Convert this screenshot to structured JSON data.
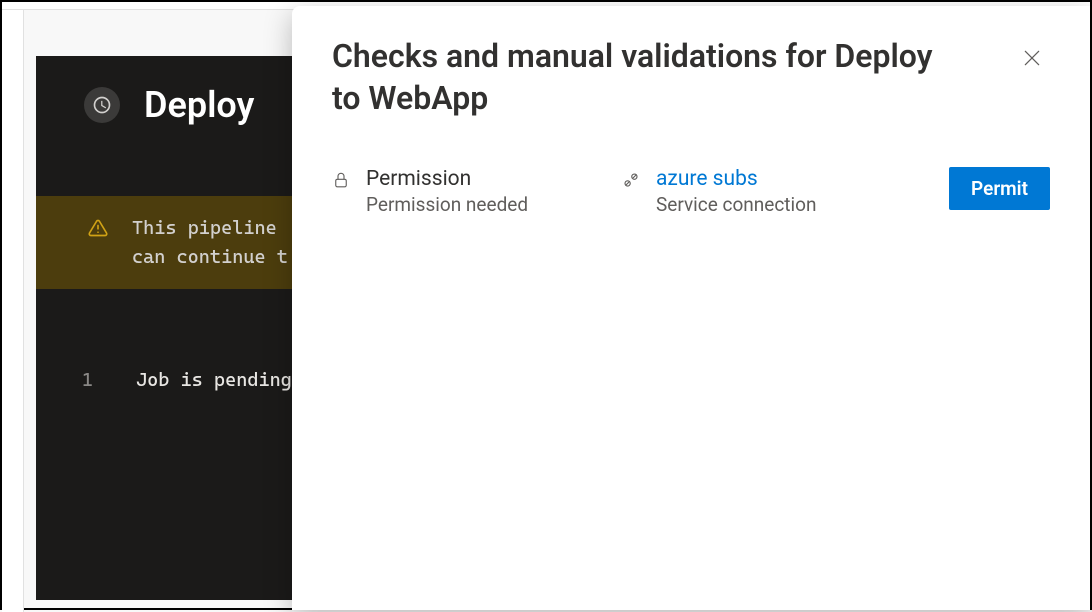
{
  "job": {
    "title": "Deploy",
    "warning_line1": "This pipeline ",
    "warning_line2": "can continue t",
    "log": {
      "lineno": "1",
      "text": "Job is pending"
    }
  },
  "dialog": {
    "title": "Checks and manual validations for Deploy to WebApp",
    "permission": {
      "title": "Permission",
      "subtitle": "Permission needed"
    },
    "resource": {
      "name": "azure subs",
      "type": "Service connection"
    },
    "permit_label": "Permit"
  }
}
